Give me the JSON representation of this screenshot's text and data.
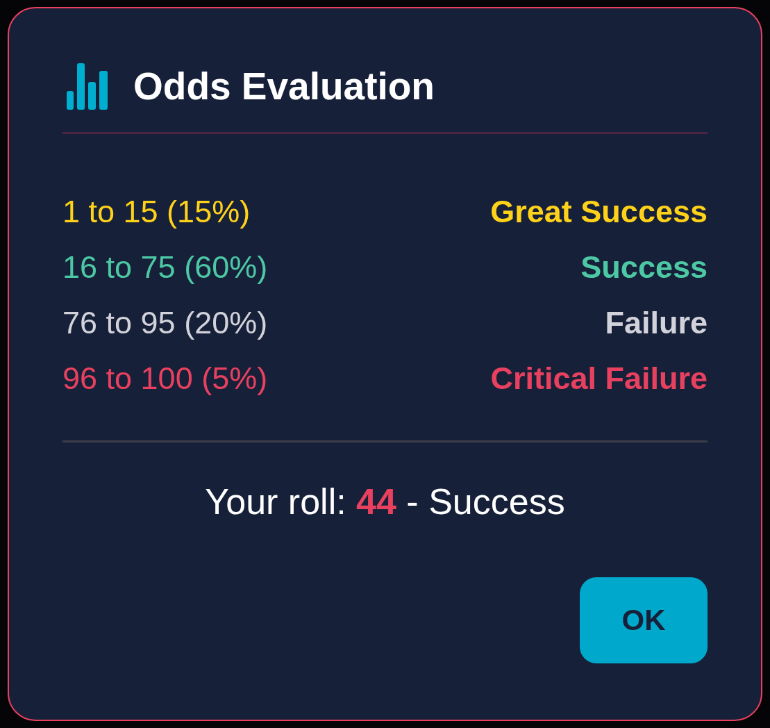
{
  "dialog": {
    "title": "Odds Evaluation"
  },
  "outcomes": [
    {
      "range": "1 to 15 (15%)",
      "result": "Great Success",
      "color": "#ffd21a"
    },
    {
      "range": "16 to 75 (60%)",
      "result": "Success",
      "color": "#4cc9a4"
    },
    {
      "range": "76 to 95 (20%)",
      "result": "Failure",
      "color": "#d2d3da"
    },
    {
      "range": "96 to 100 (5%)",
      "result": "Critical Failure",
      "color": "#e8415f"
    }
  ],
  "roll": {
    "text": "Your roll: **44** - Success"
  },
  "buttons": [
    "OK"
  ]
}
